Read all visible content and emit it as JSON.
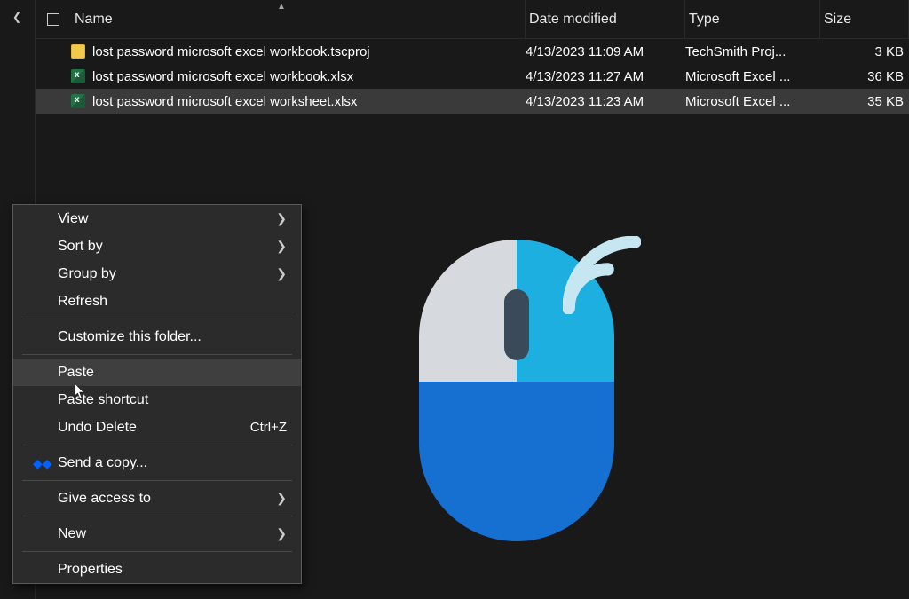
{
  "columns": {
    "name": "Name",
    "date": "Date modified",
    "type": "Type",
    "size": "Size"
  },
  "files": [
    {
      "icon": "tscproj",
      "name": "lost password microsoft excel workbook.tscproj",
      "date": "4/13/2023 11:09 AM",
      "type": "TechSmith Proj...",
      "size": "3 KB",
      "selected": false
    },
    {
      "icon": "excel",
      "name": "lost password microsoft excel workbook.xlsx",
      "date": "4/13/2023 11:27 AM",
      "type": "Microsoft Excel ...",
      "size": "36 KB",
      "selected": false
    },
    {
      "icon": "excel",
      "name": "lost password microsoft excel worksheet.xlsx",
      "date": "4/13/2023 11:23 AM",
      "type": "Microsoft Excel ...",
      "size": "35 KB",
      "selected": true
    }
  ],
  "context_menu": {
    "items": [
      {
        "label": "View",
        "submenu": true
      },
      {
        "label": "Sort by",
        "submenu": true
      },
      {
        "label": "Group by",
        "submenu": true
      },
      {
        "label": "Refresh"
      },
      {
        "sep": true
      },
      {
        "label": "Customize this folder..."
      },
      {
        "sep": true
      },
      {
        "label": "Paste",
        "highlight": true
      },
      {
        "label": "Paste shortcut"
      },
      {
        "label": "Undo Delete",
        "shortcut": "Ctrl+Z"
      },
      {
        "sep": true
      },
      {
        "label": "Send a copy...",
        "prefix": "dropbox"
      },
      {
        "sep": true
      },
      {
        "label": "Give access to",
        "submenu": true
      },
      {
        "sep": true
      },
      {
        "label": "New",
        "submenu": true
      },
      {
        "sep": true
      },
      {
        "label": "Properties"
      }
    ]
  },
  "illustration": {
    "body_color": "#1670d2",
    "left_btn_color": "#d6dadf",
    "right_btn_color": "#1cafe0",
    "wheel_color": "#3a4a58",
    "wifi_color": "#c6e7f2"
  }
}
